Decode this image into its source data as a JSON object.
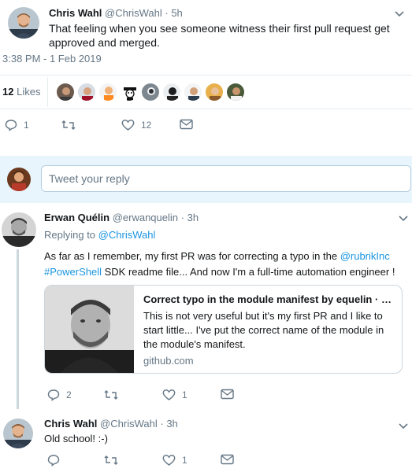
{
  "main_tweet": {
    "author_name": "Chris Wahl",
    "handle": "@ChrisWahl",
    "separator": "·",
    "time_ago": "5h",
    "text": "That feeling when you see someone witness their first pull request get approved and merged.",
    "timestamp": "3:38 PM - 1 Feb 2019",
    "likes_count": "12",
    "likes_label": "Likes",
    "likers": [
      "liker-avatar-1",
      "liker-avatar-2",
      "liker-avatar-3",
      "liker-avatar-4",
      "liker-avatar-5",
      "liker-avatar-6",
      "liker-avatar-7",
      "liker-avatar-8",
      "liker-avatar-9"
    ],
    "actions": {
      "reply_count": "1",
      "retweet_count": "",
      "like_count": "12"
    }
  },
  "reply_box": {
    "placeholder": "Tweet your reply"
  },
  "reply1": {
    "author_name": "Erwan Quélin",
    "handle": "@erwanquelin",
    "separator": "·",
    "time_ago": "3h",
    "replying_prefix": "Replying to",
    "replying_to": "@ChrisWahl",
    "text_part1": "As far as I remember, my first PR was for correcting a typo in the ",
    "mention": "@rubrikInc",
    "hashtag": "#PowerShell",
    "text_part2": " SDK readme file... And now I'm a full-time automation engineer !",
    "card": {
      "title": "Correct typo in the module manifest by equelin · Pull Request",
      "description": "This is not very useful but it's my first PR and I like to start little... I've put the correct name of the module in the module's manifest.",
      "domain": "github.com"
    },
    "actions": {
      "reply_count": "2",
      "retweet_count": "",
      "like_count": "1"
    }
  },
  "reply2": {
    "author_name": "Chris Wahl",
    "handle": "@ChrisWahl",
    "separator": "·",
    "time_ago": "3h",
    "text": "Old school! :-)",
    "actions": {
      "reply_count": "",
      "retweet_count": "",
      "like_count": "1"
    }
  },
  "colors": {
    "link": "#1b95e0",
    "secondary_text": "#657786",
    "reply_bg": "#e8f5fd",
    "divider": "#e6ecf0"
  }
}
